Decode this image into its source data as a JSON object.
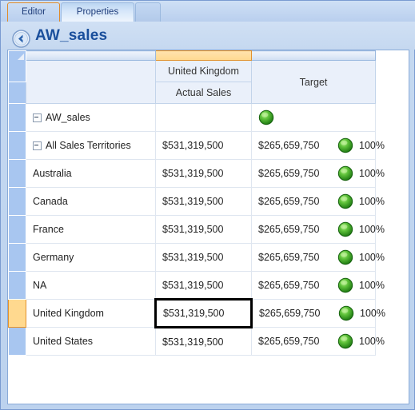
{
  "window": {
    "accent_orange": "#f8a94a",
    "accent_blue": "#a8c6f0",
    "kpi_green": "#2f9e1f"
  },
  "tabs": [
    {
      "label": "Editor",
      "active": true
    },
    {
      "label": "Properties",
      "active": false
    }
  ],
  "titlebar": {
    "back_icon": "back-arrow-icon",
    "title": "AW_sales"
  },
  "grid": {
    "corner_icon": "select-all-triangle-icon",
    "header": {
      "row1": {
        "name_col": "",
        "measure_group": "United Kingdom",
        "target": "Target"
      },
      "row2": {
        "name_col": "",
        "measure": "Actual Sales"
      }
    },
    "columns": [
      {
        "key": "name",
        "label": ""
      },
      {
        "key": "actual_sales",
        "label": "Actual Sales",
        "group": "United Kingdom",
        "selected": true
      },
      {
        "key": "target",
        "label": "Target"
      }
    ],
    "rows": [
      {
        "name": "AW_sales",
        "indent": 0,
        "expander": true,
        "actual_sales": "",
        "target": "",
        "percent": "",
        "kpi": true,
        "row_selected": false,
        "cell_selected": false
      },
      {
        "name": "All Sales Territories",
        "indent": 1,
        "expander": true,
        "actual_sales": "$531,319,500",
        "target": "$265,659,750",
        "percent": "100%",
        "kpi": true,
        "row_selected": false,
        "cell_selected": false
      },
      {
        "name": "Australia",
        "indent": 2,
        "expander": false,
        "actual_sales": "$531,319,500",
        "target": "$265,659,750",
        "percent": "100%",
        "kpi": true,
        "row_selected": false,
        "cell_selected": false
      },
      {
        "name": "Canada",
        "indent": 2,
        "expander": false,
        "actual_sales": "$531,319,500",
        "target": "$265,659,750",
        "percent": "100%",
        "kpi": true,
        "row_selected": false,
        "cell_selected": false
      },
      {
        "name": "France",
        "indent": 2,
        "expander": false,
        "actual_sales": "$531,319,500",
        "target": "$265,659,750",
        "percent": "100%",
        "kpi": true,
        "row_selected": false,
        "cell_selected": false
      },
      {
        "name": "Germany",
        "indent": 2,
        "expander": false,
        "actual_sales": "$531,319,500",
        "target": "$265,659,750",
        "percent": "100%",
        "kpi": true,
        "row_selected": false,
        "cell_selected": false
      },
      {
        "name": "NA",
        "indent": 2,
        "expander": false,
        "actual_sales": "$531,319,500",
        "target": "$265,659,750",
        "percent": "100%",
        "kpi": true,
        "row_selected": false,
        "cell_selected": false
      },
      {
        "name": "United Kingdom",
        "indent": 2,
        "expander": false,
        "actual_sales": "$531,319,500",
        "target": "$265,659,750",
        "percent": "100%",
        "kpi": true,
        "row_selected": true,
        "cell_selected": true
      },
      {
        "name": "United States",
        "indent": 2,
        "expander": false,
        "actual_sales": "$531,319,500",
        "target": "$265,659,750",
        "percent": "100%",
        "kpi": true,
        "row_selected": false,
        "cell_selected": false
      }
    ]
  }
}
